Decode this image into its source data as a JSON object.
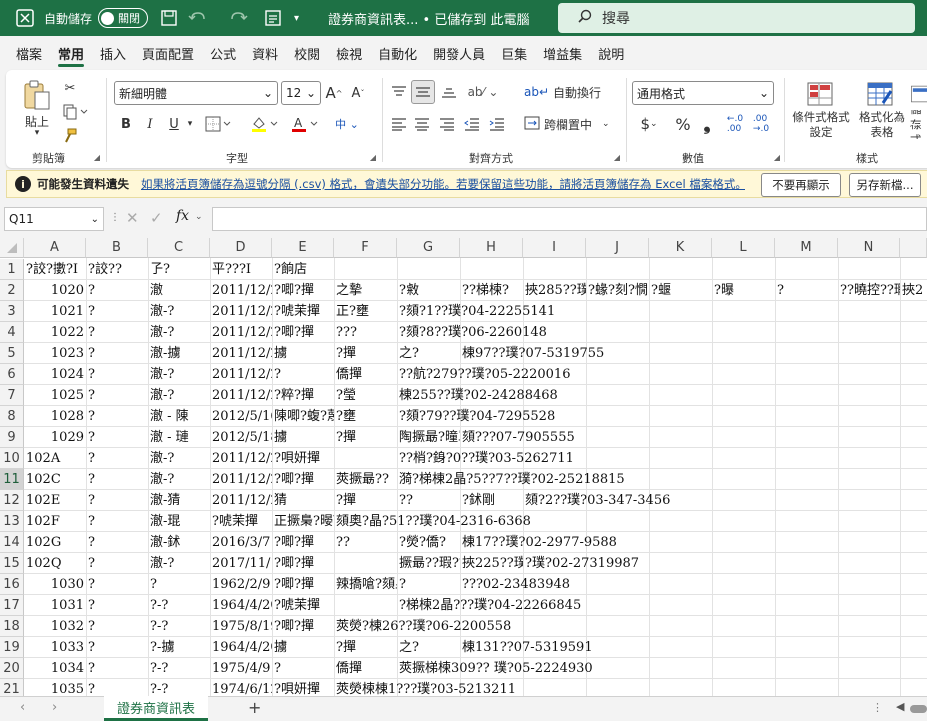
{
  "titlebar": {
    "autosave_label": "自動儲存",
    "autosave_state": "關閉",
    "doc_title": "證券商資訊表... • 已儲存到 此電腦",
    "search_placeholder": "搜尋"
  },
  "tabs": [
    "檔案",
    "常用",
    "插入",
    "頁面配置",
    "公式",
    "資料",
    "校閱",
    "檢視",
    "自動化",
    "開發人員",
    "巨集",
    "增益集",
    "說明"
  ],
  "active_tab": "常用",
  "ribbon": {
    "paste_label": "貼上",
    "clipboard_group": "剪貼簿",
    "font_name": "新細明體",
    "font_size": "12",
    "bold": "B",
    "italic": "I",
    "underline": "U",
    "font_group": "字型",
    "wrap_text": "自動換行",
    "merge_center": "跨欄置中",
    "align_group": "對齊方式",
    "number_format": "通用格式",
    "number_group": "數值",
    "conditional_format": [
      "條件式格式",
      "設定"
    ],
    "format_as_table": [
      "格式化為",
      "表格"
    ],
    "cell_styles": [
      "儲存",
      "樣式"
    ],
    "styles_group": "樣式"
  },
  "infobar": {
    "icon": "i",
    "title": "可能發生資料遺失",
    "message": "如果將活頁簿儲存為逗號分隔 (.csv) 格式，會遺失部分功能。若要保留這些功能，請將活頁簿儲存為 Excel 檔案格式。",
    "dont_show": "不要再顯示",
    "save_as": "另存新檔..."
  },
  "formula_bar": {
    "name_box": "Q11",
    "fx": "fx",
    "value": ""
  },
  "columns": [
    "A",
    "B",
    "C",
    "D",
    "E",
    "F",
    "G",
    "H",
    "I",
    "J",
    "K",
    "L",
    "M",
    "N"
  ],
  "rows": [
    {
      "n": "1",
      "cells": [
        "?詨?擻?I",
        "?詨??",
        "孒?",
        "平???Ι",
        "?餉店"
      ]
    },
    {
      "n": "2",
      "cells": [
        "1020",
        "?",
        "澈",
        "2011/12/2",
        "?唧?撣",
        "之摯",
        "?敹",
        "??梯楝?",
        "挾285??璞??典?)?",
        "?蝝?刻?憪",
        "?蝘",
        "?曝",
        "?",
        "??曉控??瑕??梯楝瑩",
        "挾2"
      ]
    },
    {
      "n": "3",
      "cells": [
        "1021",
        "?",
        "澈-?",
        "2011/12/2",
        "?唬茉撣",
        "正?壅",
        "?頦?1??璞?04-22255141"
      ]
    },
    {
      "n": "4",
      "cells": [
        "1022",
        "?",
        "澈-?",
        "2011/12/2",
        "?唧?撣",
        "???",
        "?頦?8??璞?06-2260148"
      ]
    },
    {
      "n": "5",
      "cells": [
        "1023",
        "?",
        "澈-擄",
        "2011/12/2",
        "擄",
        "?撣",
        "之?",
        "棟97??璞?07-5319755"
      ]
    },
    {
      "n": "6",
      "cells": [
        "1024",
        "?",
        "澈-?",
        "2011/12/2",
        "?",
        "僑撣",
        "??航?279??璞?05-2220016"
      ]
    },
    {
      "n": "7",
      "cells": [
        "1025",
        "?",
        "澈-?",
        "2011/12/2",
        "?粹?撣",
        "?瑩",
        "棟255??璞?02-24288468"
      ]
    },
    {
      "n": "8",
      "cells": [
        "1028",
        "?",
        "澈 - 陳",
        "2012/5/16",
        "陳唧?蝮?蔑?",
        "?壅",
        "?頦?79??璞?04-7295528"
      ]
    },
    {
      "n": "9",
      "cells": [
        "1029",
        "?",
        "澈 - 璉",
        "2012/5/18",
        "擄",
        "?撣",
        "陶撅朂?曈單",
        "頦???07-7905555"
      ]
    },
    {
      "n": "10",
      "cells": [
        "102A",
        "?",
        "澈-?",
        "2011/12/2",
        "?唄妍撣",
        "",
        "??梢?銵?0??璞?03-5262711"
      ]
    },
    {
      "n": "11",
      "cells": [
        "102C",
        "?",
        "澈-?",
        "2011/12/2",
        "?唧?撣",
        "莢撅朂??",
        "漪?梯棟2晶?5??7??璞?02-25218815"
      ]
    },
    {
      "n": "12",
      "cells": [
        "102E",
        "?",
        "澈-猜",
        "2011/12/2",
        "猜",
        "?撣",
        "??",
        "?鉥剛",
        "頦?2??璞?03-347-3456"
      ]
    },
    {
      "n": "13",
      "cells": [
        "102F",
        "?",
        "澈-琨",
        "?唬茉撣",
        "正撅梟?暥W",
        "頦奧?晶?51??璞?04-2316-6368"
      ]
    },
    {
      "n": "14",
      "cells": [
        "102G",
        "?",
        "澈-鉥",
        "2016/3/7",
        "?唧?撣",
        "??",
        "?熒?僑?",
        "棟17??璞?02-2977-9588"
      ]
    },
    {
      "n": "15",
      "cells": [
        "102Q",
        "?",
        "澈-?",
        "2017/11/1",
        "?唧?撣",
        "",
        "撅朂??瑕??梯楝瑩",
        "挾225??璞",
        "?璞?02-27319987"
      ]
    },
    {
      "n": "16",
      "cells": [
        "1030",
        "?",
        "?",
        "1962/2/9",
        "?唧?撣",
        "辣撟嗆?頦梟",
        "?",
        "???02-23483948"
      ]
    },
    {
      "n": "17",
      "cells": [
        "1031",
        "?",
        "?-?",
        "1964/4/20",
        "?唬茉撣",
        "",
        "?梯楝2晶???璞?04-22266845"
      ]
    },
    {
      "n": "18",
      "cells": [
        "1032",
        "?",
        "?-?",
        "1975/8/19",
        "?唧?撣",
        "莢熒?棟26??璞?06-2200558"
      ]
    },
    {
      "n": "19",
      "cells": [
        "1033",
        "?",
        "?-擄",
        "1964/4/20",
        "擄",
        "?撣",
        "之?",
        "棟131??07-5319591"
      ]
    },
    {
      "n": "20",
      "cells": [
        "1034",
        "?",
        "?-?",
        "1975/4/9",
        "?",
        "僑撣",
        "莢撅梯楝309?? 璞?05-2224930"
      ]
    },
    {
      "n": "21",
      "cells": [
        "1035",
        "?",
        "?-?",
        "1974/6/12",
        "?唄妍撣",
        "莢熒楝棟1???璞?03-5213211"
      ]
    }
  ],
  "sheetbar": {
    "sheet_name": "證券商資訊表",
    "add_sheet": "+"
  }
}
